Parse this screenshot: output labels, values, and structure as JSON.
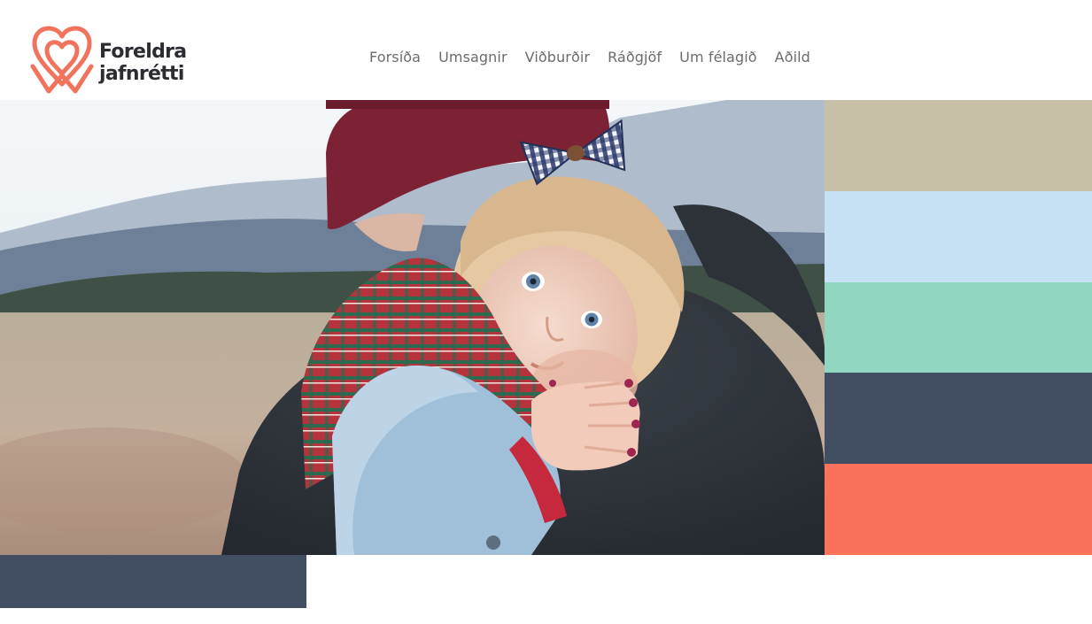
{
  "brand": {
    "name_line1": "Foreldra",
    "name_line2": "jafnrétti",
    "logo_color": "#f2735d",
    "text_color": "#2b2d33"
  },
  "nav": {
    "items": [
      {
        "label": "Forsíða"
      },
      {
        "label": "Umsagnir"
      },
      {
        "label": "Viðburðir"
      },
      {
        "label": "Ráðgjöf"
      },
      {
        "label": "Um félagið"
      },
      {
        "label": "Aðild"
      }
    ]
  },
  "hero": {
    "image_subject": "parent-holding-toddler-photo"
  },
  "palette": {
    "colors": [
      "#c8c0a6",
      "#c6e1f3",
      "#90d6c0",
      "#424f63",
      "#fb725a"
    ]
  },
  "accent_block": {
    "color": "#424f63"
  }
}
